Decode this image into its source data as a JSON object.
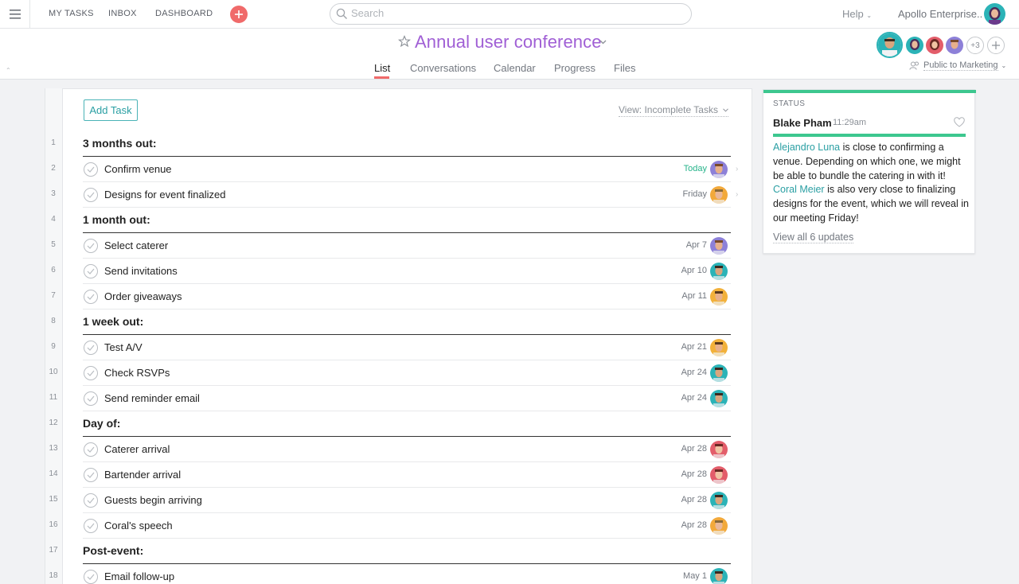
{
  "topnav": {
    "links": [
      "MY TASKS",
      "INBOX",
      "DASHBOARD"
    ],
    "search_placeholder": "Search",
    "help_label": "Help",
    "org_name": "Apollo Enterprise.."
  },
  "project": {
    "title": "Annual user conference",
    "tabs": [
      "List",
      "Conversations",
      "Calendar",
      "Progress",
      "Files"
    ],
    "active_tab": "List",
    "members_more": "+3",
    "privacy": "Public to Marketing"
  },
  "tasklist": {
    "add_task_label": "Add Task",
    "view_filter": "View: Incomplete Tasks",
    "rows": [
      {
        "n": "1",
        "type": "section",
        "title": "3 months out:"
      },
      {
        "n": "2",
        "type": "task",
        "name": "Confirm venue",
        "due": "Today",
        "today": true,
        "avatar": "purple"
      },
      {
        "n": "3",
        "type": "task",
        "name": "Designs for event finalized",
        "due": "Friday",
        "avatar": "orange"
      },
      {
        "n": "4",
        "type": "section",
        "title": "1 month out:"
      },
      {
        "n": "5",
        "type": "task",
        "name": "Select caterer",
        "due": "Apr 7",
        "avatar": "purple"
      },
      {
        "n": "6",
        "type": "task",
        "name": "Send invitations",
        "due": "Apr 10",
        "avatar": "teal"
      },
      {
        "n": "7",
        "type": "task",
        "name": "Order giveaways",
        "due": "Apr 11",
        "avatar": "gold"
      },
      {
        "n": "8",
        "type": "section",
        "title": "1 week out:"
      },
      {
        "n": "9",
        "type": "task",
        "name": "Test A/V",
        "due": "Apr 21",
        "avatar": "gold"
      },
      {
        "n": "10",
        "type": "task",
        "name": "Check RSVPs",
        "due": "Apr 24",
        "avatar": "teal"
      },
      {
        "n": "11",
        "type": "task",
        "name": "Send reminder email",
        "due": "Apr 24",
        "avatar": "teal"
      },
      {
        "n": "12",
        "type": "section",
        "title": "Day of:"
      },
      {
        "n": "13",
        "type": "task",
        "name": "Caterer arrival",
        "due": "Apr 28",
        "avatar": "red"
      },
      {
        "n": "14",
        "type": "task",
        "name": "Bartender arrival",
        "due": "Apr 28",
        "avatar": "red"
      },
      {
        "n": "15",
        "type": "task",
        "name": "Guests begin arriving",
        "due": "Apr 28",
        "avatar": "teal"
      },
      {
        "n": "16",
        "type": "task",
        "name": "Coral's speech",
        "due": "Apr 28",
        "avatar": "orange"
      },
      {
        "n": "17",
        "type": "section",
        "title": "Post-event:"
      },
      {
        "n": "18",
        "type": "task",
        "name": "Email follow-up",
        "due": "May 1",
        "avatar": "teal"
      }
    ]
  },
  "status": {
    "label": "STATUS",
    "author": "Blake Pham",
    "time": "11:29am",
    "mention1": "Alejandro Luna",
    "text1": " is close to confirming a venue. Depending on which one, we might be able to bundle the catering in with it! ",
    "mention2": "Coral Meier",
    "text2": " is also very close to finalizing designs for the event, which we will reveal in our meeting Friday!",
    "view_all": "View all 6 updates",
    "color": "#3dc78f"
  },
  "colors": {
    "accent_purple": "#a05fd5",
    "accent_teal": "#2a9fa3",
    "accent_red": "#f06a6a"
  }
}
